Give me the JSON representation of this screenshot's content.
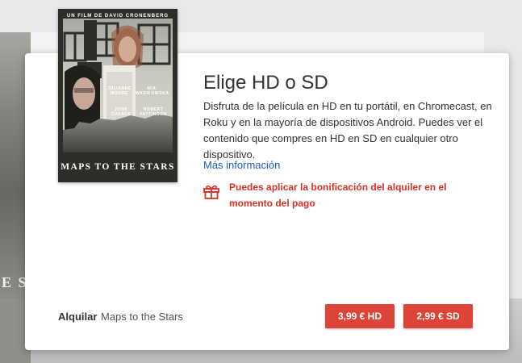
{
  "poster": {
    "director_line": "UN FILM DE DAVID CRONENBERG",
    "title": "MAPS TO THE STARS",
    "cast": [
      "JULIANNE MOORE",
      "MIA WASIKOWSKA",
      "JOHN CUSACK",
      "ROBERT PATTINSON"
    ]
  },
  "background": {
    "poster_fragment": "E S"
  },
  "dialog": {
    "title": "Elige HD o SD",
    "description": "Disfruta de la película en HD en tu portátil, en Chromecast, en Roku y en la mayoría de dispositivos Android. Puedes ver el contenido que compres en HD en SD en cualquier otro dispositivo.",
    "more_info_link": "Más información",
    "promo_icon": "gift-icon",
    "promo_text": "Puedes aplicar la bonificación del alquiler en el momento del pago"
  },
  "footer": {
    "action_label": "Alquilar",
    "movie_title": "Maps to the Stars",
    "hd_button": "3,99 € HD",
    "sd_button": "2,99 € SD"
  },
  "colors": {
    "accent": "#db4437",
    "promo_text": "#d93025",
    "link": "#1a5fb4"
  }
}
